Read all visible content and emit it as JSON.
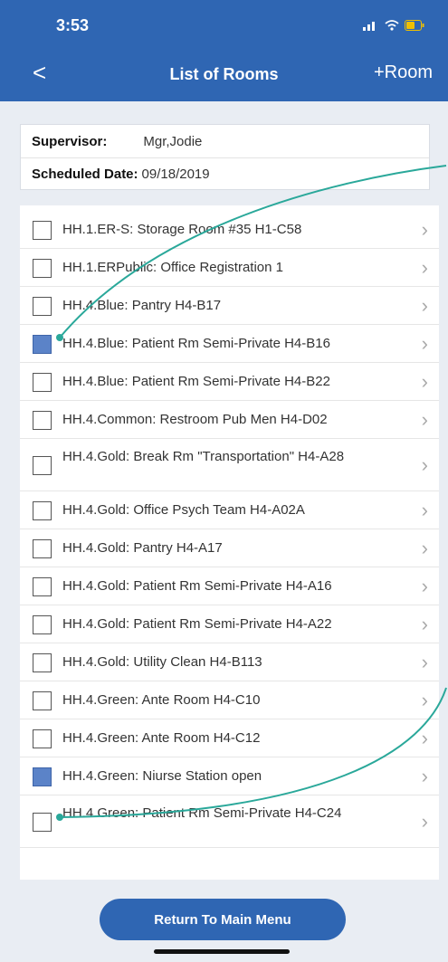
{
  "status_bar": {
    "time": "3:53"
  },
  "nav": {
    "back_glyph": "<",
    "title": "List of Rooms",
    "add_room": "+Room"
  },
  "info": {
    "supervisor_label": "Supervisor:",
    "supervisor_value": "Mgr,Jodie",
    "date_label": "Scheduled Date:",
    "date_value": "09/18/2019"
  },
  "rooms": [
    {
      "label": "HH.1.ER-S: Storage Room #35  H1-C58",
      "checked": false
    },
    {
      "label": "HH.1.ERPublic: Office Registration 1",
      "checked": false
    },
    {
      "label": "HH.4.Blue: Pantry H4-B17",
      "checked": false
    },
    {
      "label": "HH.4.Blue: Patient Rm Semi-Private H4-B16",
      "checked": true
    },
    {
      "label": "HH.4.Blue: Patient Rm Semi-Private H4-B22",
      "checked": false
    },
    {
      "label": "HH.4.Common: Restroom Pub Men H4-D02",
      "checked": false
    },
    {
      "label": "HH.4.Gold: Break Rm \"Transportation\" H4-A28",
      "checked": false
    },
    {
      "label": "HH.4.Gold: Office Psych Team H4-A02A",
      "checked": false
    },
    {
      "label": "HH.4.Gold: Pantry H4-A17",
      "checked": false
    },
    {
      "label": "HH.4.Gold: Patient Rm Semi-Private H4-A16",
      "checked": false
    },
    {
      "label": "HH.4.Gold: Patient Rm Semi-Private H4-A22",
      "checked": false
    },
    {
      "label": "HH.4.Gold: Utility Clean  H4-B113",
      "checked": false
    },
    {
      "label": "HH.4.Green: Ante Room  H4-C10",
      "checked": false
    },
    {
      "label": "HH.4.Green: Ante Room H4-C12",
      "checked": false
    },
    {
      "label": "HH.4.Green: Niurse Station open",
      "checked": true
    },
    {
      "label": "HH.4.Green: Patient Rm Semi-Private H4-C24",
      "checked": false
    }
  ],
  "footer": {
    "return_button": "Return To Main Menu"
  },
  "colors": {
    "header_blue": "#2f66b3",
    "checked_fill": "#5b83c8",
    "annotation_teal": "#2aa89a"
  },
  "icons": {
    "chevron": "chevron-right-icon",
    "signal": "signal-icon",
    "wifi": "wifi-icon",
    "battery": "battery-icon"
  }
}
